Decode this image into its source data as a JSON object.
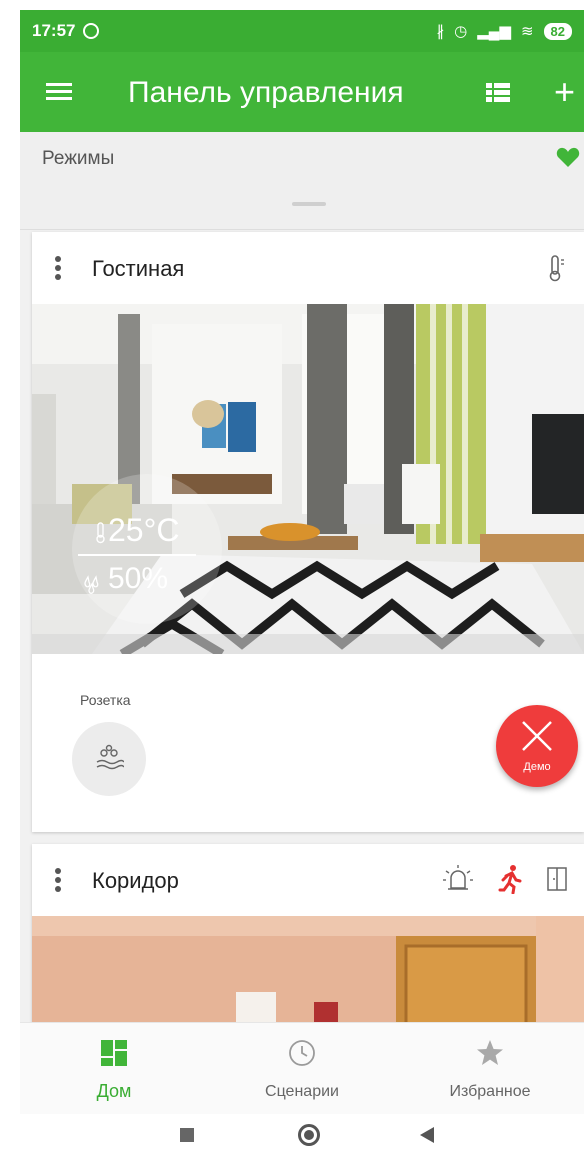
{
  "status_bar": {
    "time": "17:57",
    "battery": "82"
  },
  "app_bar": {
    "title": "Панель управления",
    "menu_icon": "hamburger-icon",
    "list_icon": "list-view-icon",
    "add_icon": "plus-icon",
    "add_label": "+"
  },
  "modes": {
    "label": "Режимы",
    "favorite_icon": "heart-icon"
  },
  "rooms": [
    {
      "name": "Гостиная",
      "sensor_icon": "thermometer-icon",
      "temperature": "25°C",
      "humidity": "50%",
      "device_label": "Розетка",
      "device_icon": "water-drops-icon"
    },
    {
      "name": "Коридор",
      "status_icons": [
        "alarm-icon",
        "motion-icon",
        "door-icon"
      ]
    }
  ],
  "demo_button": {
    "label": "Демо",
    "icon": "close-icon"
  },
  "bottom_nav": [
    {
      "label": "Дом",
      "icon": "home-grid-icon",
      "active": true
    },
    {
      "label": "Сценарии",
      "icon": "clock-icon",
      "active": false
    },
    {
      "label": "Избранное",
      "icon": "star-icon",
      "active": false
    }
  ],
  "colors": {
    "primary": "#41b539",
    "accent": "#ef3c3c",
    "motion": "#e53030"
  }
}
